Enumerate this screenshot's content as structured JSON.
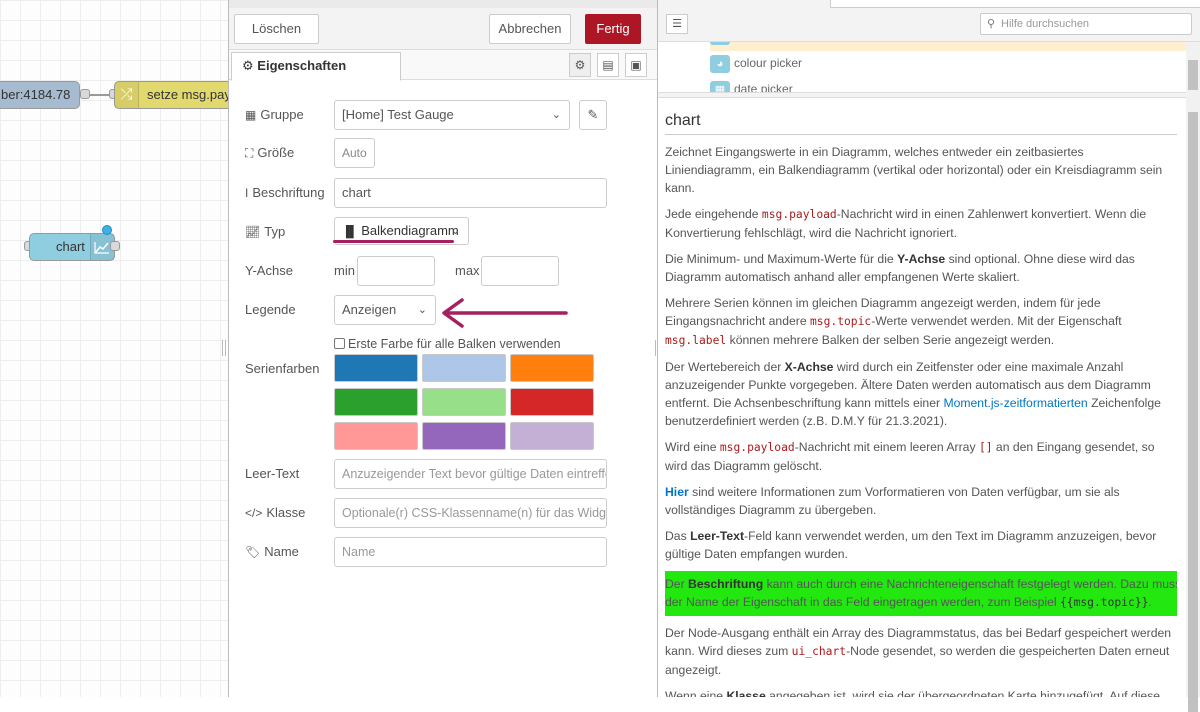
{
  "canvas": {
    "sensor_node_label": "ber:4184.78",
    "change_node_label": "setze msg.pay",
    "chart_node_label": "chart"
  },
  "tray": {
    "delete_label": "Löschen",
    "cancel_label": "Abbrechen",
    "done_label": "Fertig",
    "tab_properties": "Eigenschaften",
    "group": {
      "label": "Gruppe",
      "value": "[Home] Test Gauge"
    },
    "size": {
      "label": "Größe",
      "value": "Auto"
    },
    "caption": {
      "label": "Beschriftung",
      "value": "chart"
    },
    "type": {
      "label": "Typ",
      "value": "Balkendiagramm"
    },
    "yaxis": {
      "label": "Y-Achse",
      "min_label": "min",
      "max_label": "max",
      "min_value": "",
      "max_value": ""
    },
    "legend": {
      "label": "Legende",
      "value": "Anzeigen"
    },
    "first_color_checkbox": "Erste Farbe für alle Balken verwenden",
    "series_colors": {
      "label": "Serienfarben",
      "colors": [
        "#1f77b4",
        "#aec7e8",
        "#ff7f0e",
        "#2ca02c",
        "#98df8a",
        "#d62728",
        "#ff9896",
        "#9467bd",
        "#c5b0d5"
      ]
    },
    "empty_text": {
      "label": "Leer-Text",
      "placeholder": "Anzuzeigender Text bevor gültige Daten eintreffen"
    },
    "class": {
      "label": "Klasse",
      "placeholder": "Optionale(r) CSS-Klassenname(n) für das Widget"
    },
    "name": {
      "label": "Name",
      "placeholder": "Name"
    }
  },
  "sidebar": {
    "search_placeholder": "Hilfe durchsuchen",
    "tree_items": [
      "colour picker",
      "date picker"
    ],
    "help": {
      "title": "chart",
      "p1": "Zeichnet Eingangswerte in ein Diagramm, welches entweder ein zeitbasiertes Liniendiagramm, ein Balkendiagramm (vertikal oder horizontal) oder ein Kreisdiagramm sein kann.",
      "p2_a": "Jede eingehende ",
      "p2_code": "msg.payload",
      "p2_b": "-Nachricht wird in einen Zahlenwert konvertiert. Wenn die Konvertierung fehlschlägt, wird die Nachricht ignoriert.",
      "p3_a": "Die Minimum- und Maximum-Werte für die ",
      "p3_bold": "Y-Achse",
      "p3_b": " sind optional. Ohne diese wird das Diagramm automatisch anhand aller empfangenen Werte skaliert.",
      "p4_a": "Mehrere Serien können im gleichen Diagramm angezeigt werden, indem für jede Eingangsnachricht andere ",
      "p4_code1": "msg.topic",
      "p4_b": "-Werte verwendet werden. Mit der Eigenschaft ",
      "p4_code2": "msg.label",
      "p4_c": " können mehrere Balken der selben Serie angezeigt werden.",
      "p5_a": "Der Wertebereich der ",
      "p5_bold": "X-Achse",
      "p5_b": " wird durch ein Zeitfenster oder eine maximale Anzahl anzuzeigender Punkte vorgegeben. Ältere Daten werden automatisch aus dem Diagramm entfernt. Die Achsenbeschriftung kann mittels einer ",
      "p5_link": "Moment.js-zeitformatierten",
      "p5_c": " Zeichenfolge benutzerdefiniert werden (z.B. D.M.Y für 21.3.2021).",
      "p6_a": "Wird eine ",
      "p6_code1": "msg.payload",
      "p6_b": "-Nachricht mit einem leeren Array ",
      "p6_code2": "[]",
      "p6_c": " an den Eingang gesendet, so wird das Diagramm gelöscht.",
      "p7_link": "Hier",
      "p7_b": " sind weitere Informationen zum Vorformatieren von Daten verfügbar, um sie als vollständiges Diagramm zu übergeben.",
      "p8_a": "Das ",
      "p8_bold": "Leer-Text",
      "p8_b": "-Feld kann verwendet werden, um den Text im Diagramm anzuzeigen, bevor gültige Daten empfangen wurden.",
      "p9_a": "Der ",
      "p9_bold": "Beschriftung",
      "p9_b": " kann auch durch eine Nachrichteneigenschaft festgelegt werden. Dazu muss der Name der Eigenschaft in das Feld eingetragen werden, zum Beispiel ",
      "p9_code": "{{msg.topic}}",
      "p9_c": ".",
      "p10_a": "Der Node-Ausgang enthält ein Array des Diagrammstatus, das bei Bedarf gespeichert werden kann. Wird dieses zum ",
      "p10_code": "ui_chart",
      "p10_b": "-Node gesendet, so werden die gespeicherten Daten erneut angezeigt.",
      "p11_a": "Wenn eine ",
      "p11_bold": "Klasse",
      "p11_b": " angegeben ist, wird sie der übergeordneten Karte hinzugefügt. Auf diese Weise können Sie CSS-Stile auf die ui-card und ihre untergeordneten Elemente anwenden. Die Klasse kann zur Laufzeit festgelegt werden, indem eine Zeichenfolgeneigenschaft"
    }
  },
  "colors": {
    "accent": "#ad1625",
    "highlight": "#22e810",
    "annotation": "#a5205f"
  }
}
